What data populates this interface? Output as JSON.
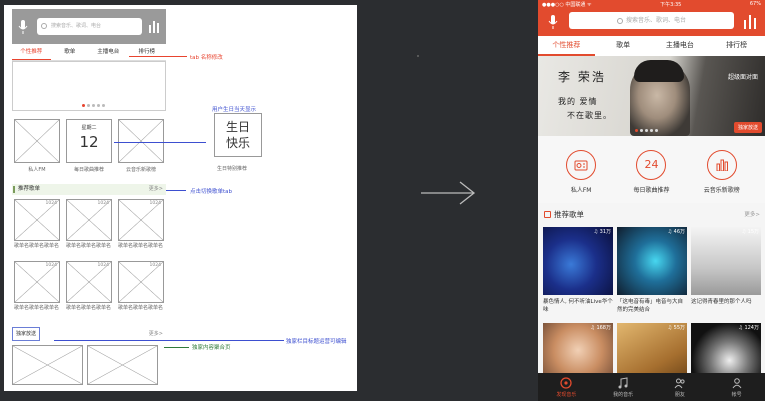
{
  "wireframe": {
    "search_placeholder": "搜索音乐、歌词、电台",
    "tabs": [
      "个性推荐",
      "歌单",
      "主播电台",
      "排行榜"
    ],
    "features": [
      {
        "label": "私人FM"
      },
      {
        "label": "每日歌曲推荐",
        "weekday": "星期二",
        "day": "12"
      },
      {
        "label": "云音乐新歌榜"
      }
    ],
    "big_calendar": {
      "line1": "生日",
      "line2": "快乐",
      "label": "生日特别推荐"
    },
    "section1": {
      "title": "推荐歌单",
      "more": "更多>"
    },
    "playlists": [
      {
        "count": "1024",
        "name": "歌单名歌单名歌单名"
      },
      {
        "count": "1024",
        "name": "歌单名歌单名歌单名"
      },
      {
        "count": "1024",
        "name": "歌单名歌单名歌单名"
      },
      {
        "count": "1024",
        "name": "歌单名歌单名歌单名"
      },
      {
        "count": "1024",
        "name": "歌单名歌单名歌单名"
      },
      {
        "count": "1024",
        "name": "歌单名歌单名歌单名"
      }
    ],
    "section2": {
      "title": "独家放送",
      "more": "更多>"
    }
  },
  "annotations": {
    "tab": "tab 名称修改",
    "birthday": "用户生日当天显示",
    "tab_switch": "点击切换歌单tab",
    "edit": "独家栏目标题运营可编辑",
    "page": "独家内容聚合页"
  },
  "phone": {
    "status": {
      "carrier": "●●●○○ 中国联通 ᯤ",
      "time": "下午3:35",
      "battery": "67%"
    },
    "search_placeholder": "搜索音乐、歌词、电台",
    "tabs": [
      "个性推荐",
      "歌单",
      "主播电台",
      "排行榜"
    ],
    "banner": {
      "name": "李 荣浩",
      "line1": "我的   爱情",
      "line2": "不在歌里。",
      "tag": "超级面对面",
      "button": "独家放送"
    },
    "features": [
      {
        "label": "私人FM",
        "icon": "radio-icon"
      },
      {
        "label": "每日歌曲推荐",
        "value": "24"
      },
      {
        "label": "云音乐新歌榜",
        "icon": "chart-icon"
      }
    ],
    "section": {
      "title": "推荐歌单",
      "more": "更多>"
    },
    "playlists": [
      {
        "count": "♫ 31万",
        "name": "暴色情人, 何不听油Live华个味"
      },
      {
        "count": "♫ 46万",
        "name": "「这电音有毒」电音与大自然的完美结合"
      },
      {
        "count": "♫ 15万",
        "name": "这记得青春里的那个人吗"
      },
      {
        "count": "♫ 168万",
        "name": ""
      },
      {
        "count": "♫ 55万",
        "name": ""
      },
      {
        "count": "♫ 124万",
        "name": ""
      }
    ],
    "nav": [
      "发现音乐",
      "我的音乐",
      "朋友",
      "帐号"
    ]
  },
  "colors": {
    "brand_red": "#e24b2e",
    "annotation_blue": "#3d4fd0"
  }
}
